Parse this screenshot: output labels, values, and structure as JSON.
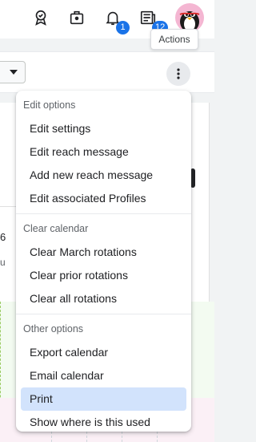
{
  "header": {
    "icons": [
      {
        "name": "award-icon"
      },
      {
        "name": "briefcase-icon"
      },
      {
        "name": "bell-icon",
        "badge": "1"
      },
      {
        "name": "news-icon",
        "badge": "12"
      }
    ],
    "avatar": "penguin-avatar"
  },
  "tooltip": {
    "text": "Actions"
  },
  "toolbar": {
    "kebab_icon": "more-vertical-icon"
  },
  "background": {
    "fragment_1": "6",
    "fragment_2": "u"
  },
  "menu": {
    "sections": [
      {
        "header": "Edit options",
        "items": [
          "Edit settings",
          "Edit reach message",
          "Add new reach message",
          "Edit associated Profiles"
        ]
      },
      {
        "header": "Clear calendar",
        "items": [
          "Clear March rotations",
          "Clear prior rotations",
          "Clear all rotations"
        ]
      },
      {
        "header": "Other options",
        "items": [
          "Export calendar",
          "Email calendar",
          "Print",
          "Show where is this used"
        ]
      }
    ],
    "highlighted_item": "Print"
  },
  "colors": {
    "accent": "#1a73e8",
    "highlight": "#d2e3fc",
    "avatar_bg": "#f4b6d2"
  }
}
